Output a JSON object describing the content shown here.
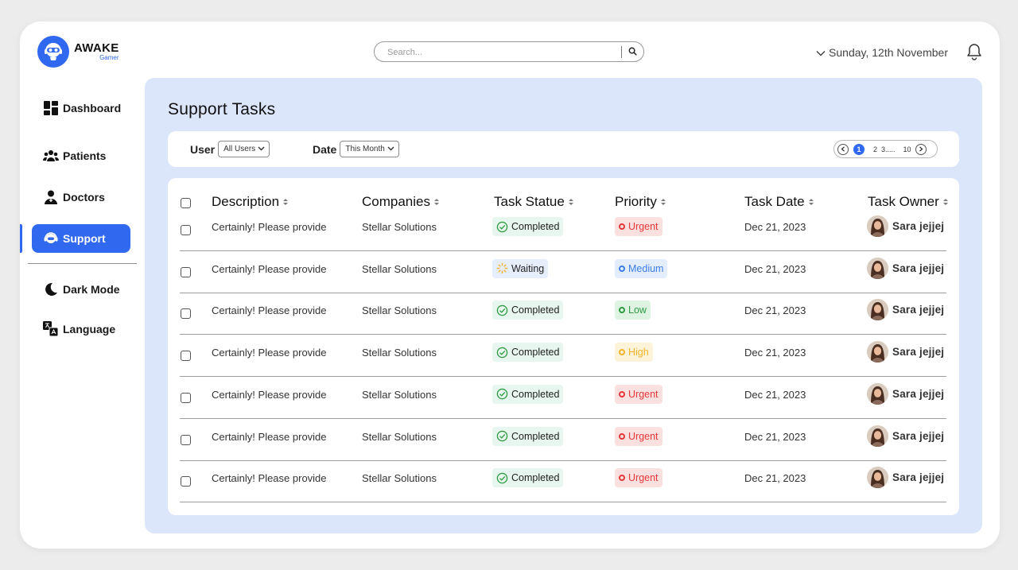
{
  "brand": {
    "title": "AWAKE",
    "subtitle": "Gamer"
  },
  "search": {
    "placeholder": "Search..."
  },
  "header": {
    "date": "Sunday, 12th November"
  },
  "sidebar": {
    "items": [
      {
        "label": "Dashboard",
        "icon": "dashboard-icon"
      },
      {
        "label": "Patients",
        "icon": "patients-icon"
      },
      {
        "label": "Doctors",
        "icon": "doctor-icon"
      },
      {
        "label": "Support",
        "icon": "support-icon",
        "active": true
      },
      {
        "label": "Dark Mode",
        "icon": "moon-icon"
      },
      {
        "label": "Language",
        "icon": "language-icon"
      }
    ]
  },
  "main": {
    "title": "Support Tasks",
    "filters": {
      "user_label": "User",
      "user_value": "All Users",
      "date_label": "Date",
      "date_value": "This Month"
    },
    "pagination": {
      "pages": [
        "1",
        "2",
        "3.....",
        "10"
      ],
      "current": "1"
    },
    "table": {
      "headers": [
        "Description",
        "Companies",
        "Task Statue",
        "Priority",
        "Task Date",
        "Task Owner"
      ],
      "rows": [
        {
          "description": "Certainly! Please provide",
          "company": "Stellar Solutions",
          "status": "Completed",
          "priority": "Urgent",
          "date": "Dec 21, 2023",
          "owner": "Sara jejjej"
        },
        {
          "description": "Certainly! Please provide",
          "company": "Stellar Solutions",
          "status": "Waiting",
          "priority": "Medium",
          "date": "Dec 21, 2023",
          "owner": "Sara jejjej"
        },
        {
          "description": "Certainly! Please provide",
          "company": "Stellar Solutions",
          "status": "Completed",
          "priority": "Low",
          "date": "Dec 21, 2023",
          "owner": "Sara jejjej"
        },
        {
          "description": "Certainly! Please provide",
          "company": "Stellar Solutions",
          "status": "Completed",
          "priority": "High",
          "date": "Dec 21, 2023",
          "owner": "Sara jejjej"
        },
        {
          "description": "Certainly! Please provide",
          "company": "Stellar Solutions",
          "status": "Completed",
          "priority": "Urgent",
          "date": "Dec 21, 2023",
          "owner": "Sara jejjej"
        },
        {
          "description": "Certainly! Please provide",
          "company": "Stellar Solutions",
          "status": "Completed",
          "priority": "Urgent",
          "date": "Dec 21, 2023",
          "owner": "Sara jejjej"
        },
        {
          "description": "Certainly! Please provide",
          "company": "Stellar Solutions",
          "status": "Completed",
          "priority": "Urgent",
          "date": "Dec 21, 2023",
          "owner": "Sara jejjej"
        }
      ]
    }
  },
  "colors": {
    "accent": "#3069f0",
    "main_bg": "#dce6fb",
    "urgent": "#e5383b",
    "urgent_bg": "#fbe0e0",
    "medium": "#3b7de8",
    "medium_bg": "#e4edfb",
    "low": "#2e9b42",
    "low_bg": "#dff3e3",
    "high": "#f2b32b",
    "high_bg": "#fdf3d9"
  }
}
